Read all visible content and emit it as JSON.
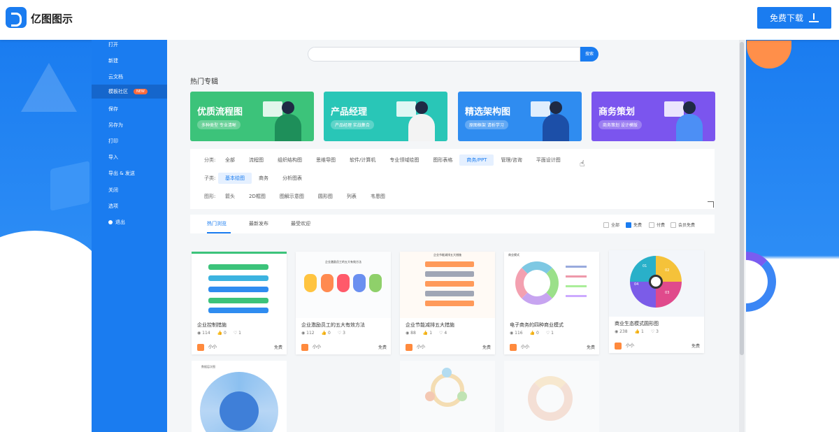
{
  "header": {
    "app_name": "亿图图示",
    "download_label": "免费下载"
  },
  "sidebar": {
    "items": [
      {
        "label": "打开"
      },
      {
        "label": "新建"
      },
      {
        "label": "云文档"
      },
      {
        "label": "模板社区",
        "badge": "NEW"
      },
      {
        "label": "保存"
      },
      {
        "label": "另存为"
      },
      {
        "label": "打印"
      },
      {
        "label": "导入"
      },
      {
        "label": "导出 & 发送"
      },
      {
        "label": "关闭"
      },
      {
        "label": "选项"
      },
      {
        "label": "退出"
      }
    ]
  },
  "search": {
    "placeholder": "",
    "button_label": "搜索"
  },
  "section_title": "热门专辑",
  "banners": [
    {
      "title": "优质流程图",
      "tag": "多种类型 专业清晰",
      "color": "#3cc37a"
    },
    {
      "title": "产品经理",
      "tag": "产品经理 实战集合",
      "color": "#29c6b7"
    },
    {
      "title": "精选架构图",
      "tag": "原图框架 请析学习",
      "color": "#2f8cf0"
    },
    {
      "title": "商务策划",
      "tag": "商务策划 设计模版",
      "color": "#7b55ee"
    }
  ],
  "filters": {
    "category_label": "分类:",
    "categories": [
      "全部",
      "流程图",
      "组织结构图",
      "思维导图",
      "软件/计算机",
      "专业领域绘图",
      "图形表格",
      "商务/PPT",
      "管理/咨询",
      "平面设计图"
    ],
    "category_selected": "商务/PPT",
    "sub_label": "子类:",
    "subs": [
      "基本绘图",
      "商务",
      "分析图表"
    ],
    "sub_selected": "基本绘图",
    "shape_label": "图形:",
    "shapes": [
      "箭头",
      "2D框图",
      "图解示意图",
      "圆形图",
      "列表",
      "韦恩图"
    ]
  },
  "sort_tabs": [
    "热门浏览",
    "最新发布",
    "最受欢迎"
  ],
  "sort_selected": "热门浏览",
  "filter_checks": [
    {
      "label": "全部",
      "checked": false
    },
    {
      "label": "免费",
      "checked": true
    },
    {
      "label": "付费",
      "checked": false
    },
    {
      "label": "会员免费",
      "checked": false
    }
  ],
  "cards": [
    {
      "title": "企业控制措施",
      "views": "114",
      "likes": "0",
      "favs": "1",
      "author": "小小",
      "price": "免费"
    },
    {
      "title": "企业激励员工的五大有效方法",
      "views": "112",
      "likes": "0",
      "favs": "3",
      "author": "小小",
      "price": "免费"
    },
    {
      "title": "企业节能减排五大措施",
      "views": "88",
      "likes": "1",
      "favs": "4",
      "author": "小小",
      "price": "免费"
    },
    {
      "title": "电子商务的四种商业模式",
      "views": "116",
      "likes": "0",
      "favs": "1",
      "author": "小小",
      "price": "免费"
    },
    {
      "title": "商业生态模式圆形图",
      "views": "238",
      "likes": "1",
      "favs": "3",
      "author": "小小",
      "price": "免费"
    }
  ],
  "thumb_texts": {
    "card2_heading": "企业激励员工的五大有效方法",
    "card3_heading": "企业节能减排五大措施",
    "card4_heading": "商业模式",
    "card5_labels": [
      "01",
      "02",
      "03",
      "04"
    ],
    "row2_first_heading": "数据层次图"
  }
}
